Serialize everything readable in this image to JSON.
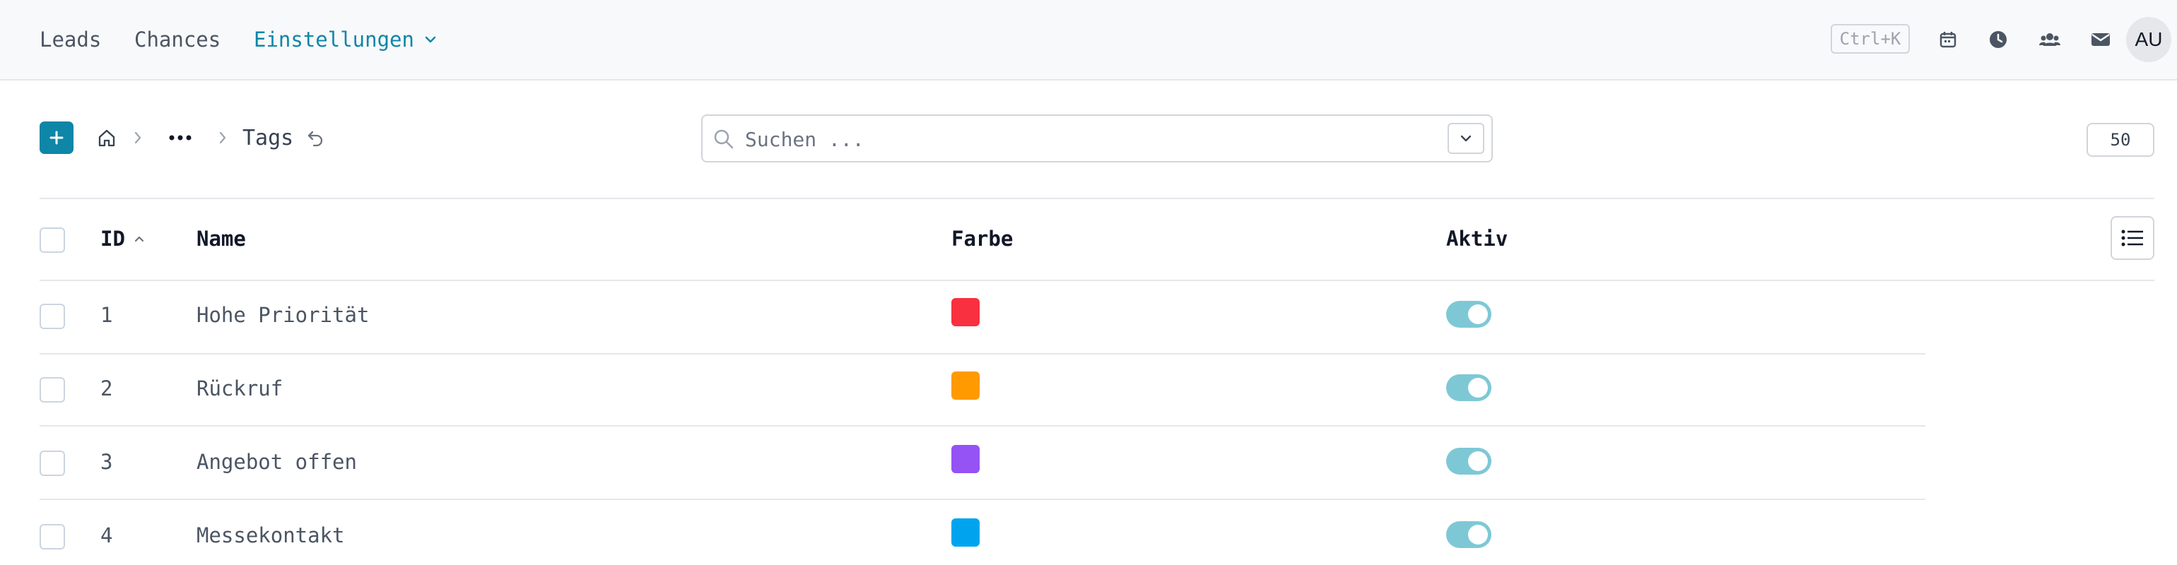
{
  "nav": {
    "leads": "Leads",
    "chances": "Chances",
    "settings": "Einstellungen"
  },
  "header": {
    "shortcut": "Ctrl+K",
    "avatar_initials": "AU",
    "icons": [
      "calendar-icon",
      "clock-icon",
      "users-icon",
      "mail-icon"
    ]
  },
  "toolbar": {
    "breadcrumb": {
      "ellipsis": "•••",
      "current": "Tags"
    },
    "search": {
      "placeholder": "Suchen ..."
    },
    "page_size": "50"
  },
  "table": {
    "columns": {
      "id": "ID",
      "name": "Name",
      "color": "Farbe",
      "active": "Aktiv"
    },
    "sort": {
      "column": "ID",
      "direction": "asc"
    },
    "rows": [
      {
        "id": "1",
        "name": "Hohe Priorität",
        "color": "#f9303f",
        "active": true
      },
      {
        "id": "2",
        "name": "Rückruf",
        "color": "#ff9a00",
        "active": true
      },
      {
        "id": "3",
        "name": "Angebot offen",
        "color": "#9552f5",
        "active": true
      },
      {
        "id": "4",
        "name": "Messekontakt",
        "color": "#00a4ee",
        "active": true
      }
    ]
  },
  "colors": {
    "accent": "#0e86a8",
    "toggle_on": "#7ec8d6"
  }
}
